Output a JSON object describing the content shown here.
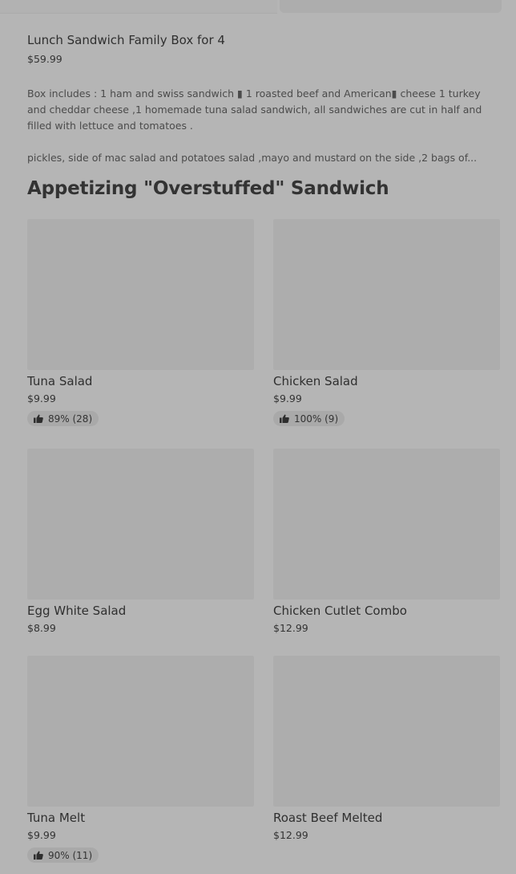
{
  "featured": {
    "title": "Lunch Sandwich Family Box for 4",
    "price": "$59.99",
    "description_line1": "Box includes : 1 ham and swiss sandwich ▮ 1 roasted beef and American▮ cheese 1 turkey and cheddar cheese ,1 homemade tuna salad sandwich, all sandwiches are cut in half and filled with lettuce and tomatoes .",
    "description_line2": "pickles, side of mac salad and potatoes salad ,mayo and mustard on the side ,2 bags of..."
  },
  "section": {
    "title": "Appetizing \"Overstuffed\" Sandwich"
  },
  "items": [
    {
      "name": "Tuna Salad",
      "price": "$9.99",
      "rating": "89% (28)"
    },
    {
      "name": "Chicken Salad",
      "price": "$9.99",
      "rating": "100% (9)"
    },
    {
      "name": "Egg White Salad",
      "price": "$8.99",
      "rating": ""
    },
    {
      "name": "Chicken Cutlet Combo",
      "price": "$12.99",
      "rating": ""
    },
    {
      "name": "Tuna Melt",
      "price": "$9.99",
      "rating": "90% (11)"
    },
    {
      "name": "Roast Beef Melted",
      "price": "$12.99",
      "rating": ""
    }
  ],
  "icons": {
    "rating": "thumbs-up-icon"
  },
  "colors": {
    "overlay_background": "#b5b5b5",
    "image_placeholder": "#adadad",
    "rating_pill": "#a9a9a9"
  }
}
